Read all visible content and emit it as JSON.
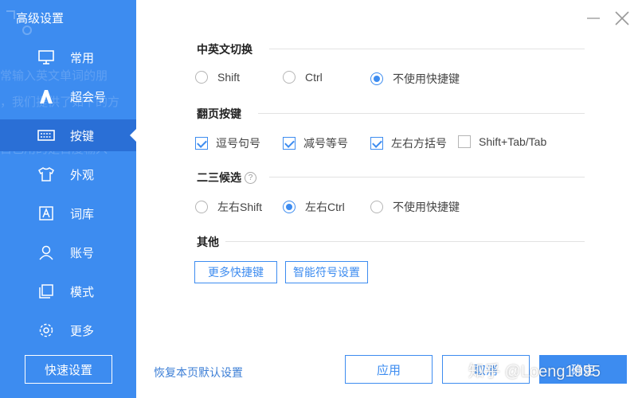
{
  "sidebar": {
    "title": "高级设置",
    "ghost_lines": [
      "常输入英文单词的朋",
      "，我们提供了如下的方",
      "自己用的是百度输入"
    ],
    "items": [
      {
        "label": "常用",
        "icon": "monitor-icon"
      },
      {
        "label": "超会号",
        "icon": "super-member-icon"
      },
      {
        "label": "按键",
        "icon": "keyboard-icon"
      },
      {
        "label": "外观",
        "icon": "tshirt-icon"
      },
      {
        "label": "词库",
        "icon": "dictionary-icon"
      },
      {
        "label": "账号",
        "icon": "user-icon"
      },
      {
        "label": "模式",
        "icon": "mode-icon"
      },
      {
        "label": "更多",
        "icon": "gear-icon"
      }
    ],
    "active_index": 2,
    "quick_settings": "快速设置"
  },
  "sections": {
    "switch": {
      "title": "中英文切换",
      "options": [
        "Shift",
        "Ctrl",
        "不使用快捷键"
      ],
      "selected": "不使用快捷键"
    },
    "paging": {
      "title": "翻页按键",
      "options": [
        {
          "label": "逗号句号",
          "checked": true
        },
        {
          "label": "减号等号",
          "checked": true
        },
        {
          "label": "左右方括号",
          "checked": true
        },
        {
          "label": "Shift+Tab/Tab",
          "checked": false
        }
      ]
    },
    "candidates": {
      "title": "二三候选",
      "help": "?",
      "options": [
        "左右Shift",
        "左右Ctrl",
        "不使用快捷键"
      ],
      "selected": "左右Ctrl"
    },
    "other": {
      "title": "其他",
      "buttons": [
        "更多快捷键",
        "智能符号设置"
      ]
    }
  },
  "footer": {
    "restore": "恢复本页默认设置",
    "apply": "应用",
    "cancel": "取消",
    "ok": "确定"
  },
  "watermark": "知乎 @Loeng1995",
  "colors": {
    "accent": "#3d8cf0",
    "active_nav": "#2a6fd6"
  }
}
